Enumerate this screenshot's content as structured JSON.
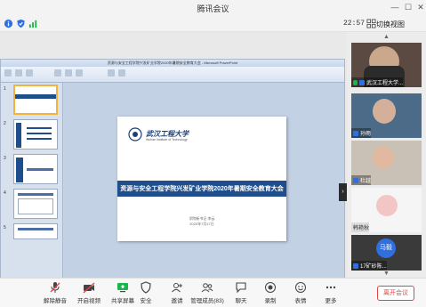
{
  "window": {
    "title": "腾讯会议"
  },
  "toolbar": {
    "time": "22:57",
    "switch_view_label": "切换视图"
  },
  "ppt": {
    "window_title": "资源与安全工程学院兴发矿业学院2020年暑期安全教育大会 - Microsoft PowerPoint",
    "slide": {
      "logo_text": "武汉工程大学",
      "logo_sub": "Wuhan Institute of Technology",
      "title": "资源与安全工程学院兴发矿业学院2020年暑期安全教育大会",
      "subtitle1": "学院新书记  李云",
      "subtitle2": "2020年7月17日"
    },
    "thumbnails": [
      "1",
      "2",
      "3",
      "4",
      "5"
    ]
  },
  "participants": [
    {
      "name": "武汉工程大学...",
      "mic": true
    },
    {
      "name": "孙雨",
      "mic": false
    },
    {
      "name": "杜越",
      "mic": false
    },
    {
      "name": "韩艳秋",
      "mic": false
    },
    {
      "name": "17矿砂陈...",
      "avatar_text": "马毅",
      "mic": false
    }
  ],
  "controls": [
    {
      "label": "解除静音",
      "icon": "microphone-muted-icon"
    },
    {
      "label": "开启视频",
      "icon": "video-off-icon"
    },
    {
      "label": "共享屏幕",
      "icon": "share-screen-icon"
    },
    {
      "label": "安全",
      "icon": "shield-icon"
    },
    {
      "label": "邀请",
      "icon": "invite-icon"
    },
    {
      "label": "管理成员(83)",
      "icon": "members-icon"
    },
    {
      "label": "聊天",
      "icon": "chat-icon"
    },
    {
      "label": "录制",
      "icon": "record-icon"
    },
    {
      "label": "表情",
      "icon": "emoji-icon"
    },
    {
      "label": "更多",
      "icon": "more-icon"
    }
  ],
  "leave_button": "离开会议",
  "colors": {
    "accent": "#2f6fe0",
    "leave": "#e04545",
    "slide_band": "#1f4e8c"
  }
}
